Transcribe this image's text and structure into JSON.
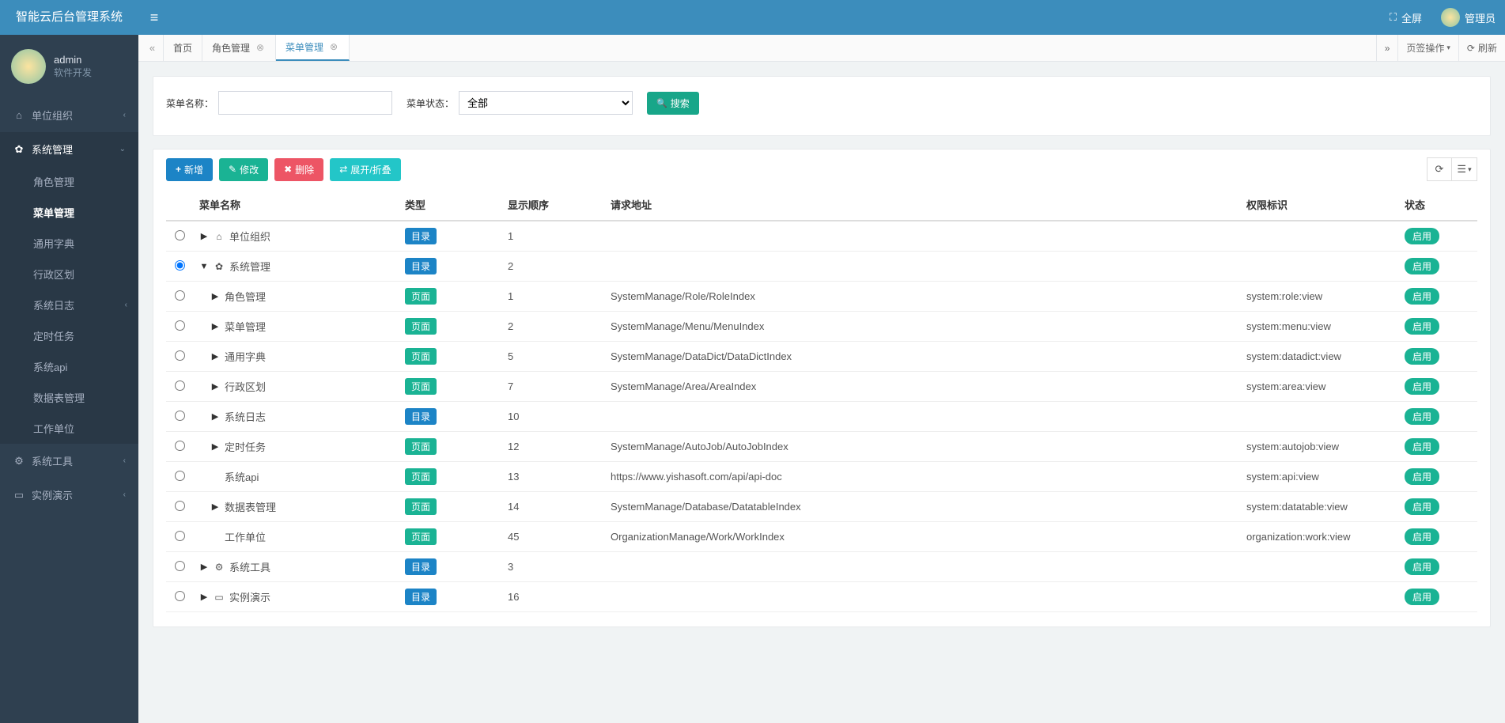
{
  "header": {
    "system_title": "智能云后台管理系统",
    "fullscreen_label": "全屏",
    "admin_label": "管理员"
  },
  "sidebar": {
    "user_name": "admin",
    "user_role": "软件开发",
    "menu": [
      {
        "label": "单位组织",
        "icon": "home",
        "caret": "left",
        "children": []
      },
      {
        "label": "系统管理",
        "icon": "gear",
        "caret": "down",
        "open": true,
        "children": [
          {
            "label": "角色管理"
          },
          {
            "label": "菜单管理",
            "active": true
          },
          {
            "label": "通用字典"
          },
          {
            "label": "行政区划"
          },
          {
            "label": "系统日志",
            "caret": "left"
          },
          {
            "label": "定时任务"
          },
          {
            "label": "系统api"
          },
          {
            "label": "数据表管理"
          },
          {
            "label": "工作单位"
          }
        ]
      },
      {
        "label": "系统工具",
        "icon": "cogs",
        "caret": "left",
        "children": []
      },
      {
        "label": "实例演示",
        "icon": "screen",
        "caret": "left",
        "children": []
      }
    ]
  },
  "tabs": {
    "list": [
      {
        "label": "首页",
        "closable": false
      },
      {
        "label": "角色管理",
        "closable": true
      },
      {
        "label": "菜单管理",
        "closable": true,
        "active": true
      }
    ],
    "tab_ops_label": "页签操作",
    "refresh_label": "刷新"
  },
  "search": {
    "menu_name_label": "菜单名称：",
    "menu_status_label": "菜单状态：",
    "status_selected": "全部",
    "search_btn": "搜索"
  },
  "toolbar": {
    "add_label": "新增",
    "edit_label": "修改",
    "delete_label": "删除",
    "toggle_label": "展开/折叠"
  },
  "table": {
    "columns": {
      "name": "菜单名称",
      "type": "类型",
      "order": "显示顺序",
      "url": "请求地址",
      "perm": "权限标识",
      "status": "状态"
    },
    "type_labels": {
      "dir": "目录",
      "page": "页面"
    },
    "status_label": "启用",
    "rows": [
      {
        "indent": 0,
        "caret": "right",
        "icon": "home",
        "name": "单位组织",
        "type": "dir",
        "order": "1",
        "url": "",
        "perm": "",
        "radio": false
      },
      {
        "indent": 0,
        "caret": "down",
        "icon": "gear",
        "name": "系统管理",
        "type": "dir",
        "order": "2",
        "url": "",
        "perm": "",
        "radio": true
      },
      {
        "indent": 1,
        "caret": "right",
        "icon": "",
        "name": "角色管理",
        "type": "page",
        "order": "1",
        "url": "SystemManage/Role/RoleIndex",
        "perm": "system:role:view",
        "radio": false
      },
      {
        "indent": 1,
        "caret": "right",
        "icon": "",
        "name": "菜单管理",
        "type": "page",
        "order": "2",
        "url": "SystemManage/Menu/MenuIndex",
        "perm": "system:menu:view",
        "radio": false
      },
      {
        "indent": 1,
        "caret": "right",
        "icon": "",
        "name": "通用字典",
        "type": "page",
        "order": "5",
        "url": "SystemManage/DataDict/DataDictIndex",
        "perm": "system:datadict:view",
        "radio": false
      },
      {
        "indent": 1,
        "caret": "right",
        "icon": "",
        "name": "行政区划",
        "type": "page",
        "order": "7",
        "url": "SystemManage/Area/AreaIndex",
        "perm": "system:area:view",
        "radio": false
      },
      {
        "indent": 1,
        "caret": "right",
        "icon": "",
        "name": "系统日志",
        "type": "dir",
        "order": "10",
        "url": "",
        "perm": "",
        "radio": false
      },
      {
        "indent": 1,
        "caret": "right",
        "icon": "",
        "name": "定时任务",
        "type": "page",
        "order": "12",
        "url": "SystemManage/AutoJob/AutoJobIndex",
        "perm": "system:autojob:view",
        "radio": false
      },
      {
        "indent": 1,
        "caret": "none",
        "icon": "",
        "name": "系统api",
        "type": "page",
        "order": "13",
        "url": "https://www.yishasoft.com/api/api-doc",
        "perm": "system:api:view",
        "radio": false
      },
      {
        "indent": 1,
        "caret": "right",
        "icon": "",
        "name": "数据表管理",
        "type": "page",
        "order": "14",
        "url": "SystemManage/Database/DatatableIndex",
        "perm": "system:datatable:view",
        "radio": false
      },
      {
        "indent": 1,
        "caret": "none",
        "icon": "",
        "name": "工作单位",
        "type": "page",
        "order": "45",
        "url": "OrganizationManage/Work/WorkIndex",
        "perm": "organization:work:view",
        "radio": false
      },
      {
        "indent": 0,
        "caret": "right",
        "icon": "cogs",
        "name": "系统工具",
        "type": "dir",
        "order": "3",
        "url": "",
        "perm": "",
        "radio": false
      },
      {
        "indent": 0,
        "caret": "right",
        "icon": "screen",
        "name": "实例演示",
        "type": "dir",
        "order": "16",
        "url": "",
        "perm": "",
        "radio": false
      }
    ]
  }
}
